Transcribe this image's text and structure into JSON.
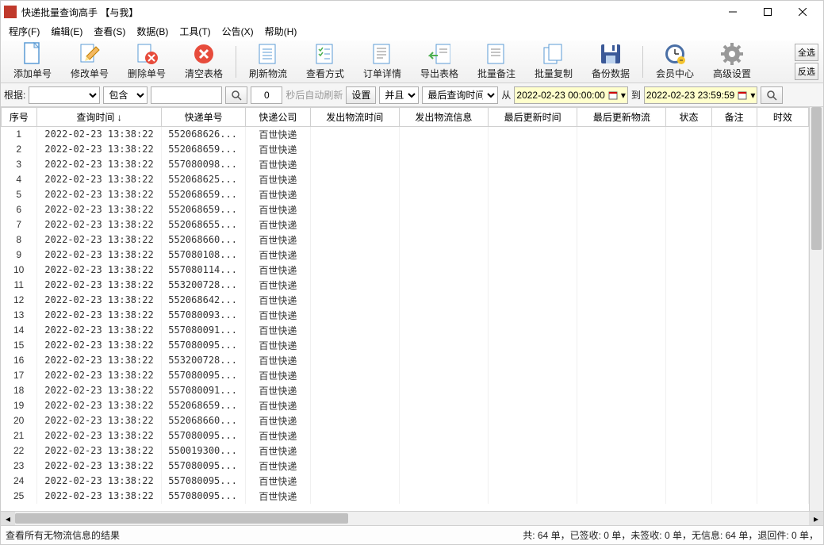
{
  "window": {
    "title": "快递批量查询高手 【与我】"
  },
  "menu": {
    "program": "程序(F)",
    "edit": "编辑(E)",
    "view": "查看(S)",
    "data": "数据(B)",
    "tools": "工具(T)",
    "notice": "公告(X)",
    "help": "帮助(H)"
  },
  "toolbar": {
    "add": "添加单号",
    "modify": "修改单号",
    "delete": "删除单号",
    "clear": "清空表格",
    "refresh": "刷新物流",
    "method": "查看方式",
    "detail": "订单详情",
    "export": "导出表格",
    "batchnote": "批量备注",
    "batchcopy": "批量复制",
    "backup": "备份数据",
    "member": "会员中心",
    "advanced": "高级设置",
    "selall": "全选",
    "selinv": "反选"
  },
  "filter": {
    "basis": "根据:",
    "contain": "包含",
    "seconds": "0",
    "auto_hint": "秒后自动刷新",
    "settings": "设置",
    "and": "并且",
    "lastquery": "最后查询时间",
    "from": "从",
    "to": "到",
    "date_from": "2022-02-23 00:00:00",
    "date_to": "2022-02-23 23:59:59"
  },
  "columns": {
    "seq": "序号",
    "qtime": "查询时间 ↓",
    "trackno": "快递单号",
    "company": "快递公司",
    "senttime": "发出物流时间",
    "sentinfo": "发出物流信息",
    "lasttime": "最后更新时间",
    "lastinfo": "最后更新物流",
    "status": "状态",
    "remark": "备注",
    "timeliness": "时效"
  },
  "rows": [
    {
      "seq": 1,
      "qtime": "2022-02-23 13:38:22",
      "trackno": "552068626...",
      "company": "百世快递"
    },
    {
      "seq": 2,
      "qtime": "2022-02-23 13:38:22",
      "trackno": "552068659...",
      "company": "百世快递"
    },
    {
      "seq": 3,
      "qtime": "2022-02-23 13:38:22",
      "trackno": "557080098...",
      "company": "百世快递"
    },
    {
      "seq": 4,
      "qtime": "2022-02-23 13:38:22",
      "trackno": "552068625...",
      "company": "百世快递"
    },
    {
      "seq": 5,
      "qtime": "2022-02-23 13:38:22",
      "trackno": "552068659...",
      "company": "百世快递"
    },
    {
      "seq": 6,
      "qtime": "2022-02-23 13:38:22",
      "trackno": "552068659...",
      "company": "百世快递"
    },
    {
      "seq": 7,
      "qtime": "2022-02-23 13:38:22",
      "trackno": "552068655...",
      "company": "百世快递"
    },
    {
      "seq": 8,
      "qtime": "2022-02-23 13:38:22",
      "trackno": "552068660...",
      "company": "百世快递"
    },
    {
      "seq": 9,
      "qtime": "2022-02-23 13:38:22",
      "trackno": "557080108...",
      "company": "百世快递"
    },
    {
      "seq": 10,
      "qtime": "2022-02-23 13:38:22",
      "trackno": "557080114...",
      "company": "百世快递"
    },
    {
      "seq": 11,
      "qtime": "2022-02-23 13:38:22",
      "trackno": "553200728...",
      "company": "百世快递"
    },
    {
      "seq": 12,
      "qtime": "2022-02-23 13:38:22",
      "trackno": "552068642...",
      "company": "百世快递"
    },
    {
      "seq": 13,
      "qtime": "2022-02-23 13:38:22",
      "trackno": "557080093...",
      "company": "百世快递"
    },
    {
      "seq": 14,
      "qtime": "2022-02-23 13:38:22",
      "trackno": "557080091...",
      "company": "百世快递"
    },
    {
      "seq": 15,
      "qtime": "2022-02-23 13:38:22",
      "trackno": "557080095...",
      "company": "百世快递"
    },
    {
      "seq": 16,
      "qtime": "2022-02-23 13:38:22",
      "trackno": "553200728...",
      "company": "百世快递"
    },
    {
      "seq": 17,
      "qtime": "2022-02-23 13:38:22",
      "trackno": "557080095...",
      "company": "百世快递"
    },
    {
      "seq": 18,
      "qtime": "2022-02-23 13:38:22",
      "trackno": "557080091...",
      "company": "百世快递"
    },
    {
      "seq": 19,
      "qtime": "2022-02-23 13:38:22",
      "trackno": "552068659...",
      "company": "百世快递"
    },
    {
      "seq": 20,
      "qtime": "2022-02-23 13:38:22",
      "trackno": "552068660...",
      "company": "百世快递"
    },
    {
      "seq": 21,
      "qtime": "2022-02-23 13:38:22",
      "trackno": "557080095...",
      "company": "百世快递"
    },
    {
      "seq": 22,
      "qtime": "2022-02-23 13:38:22",
      "trackno": "550019300...",
      "company": "百世快递"
    },
    {
      "seq": 23,
      "qtime": "2022-02-23 13:38:22",
      "trackno": "557080095...",
      "company": "百世快递"
    },
    {
      "seq": 24,
      "qtime": "2022-02-23 13:38:22",
      "trackno": "557080095...",
      "company": "百世快递"
    },
    {
      "seq": 25,
      "qtime": "2022-02-23 13:38:22",
      "trackno": "557080095...",
      "company": "百世快递"
    }
  ],
  "status": {
    "left": "查看所有无物流信息的结果",
    "right": "共: 64 单，已签收: 0 单，未签收: 0 单，无信息: 64 单，退回件: 0 单，"
  }
}
